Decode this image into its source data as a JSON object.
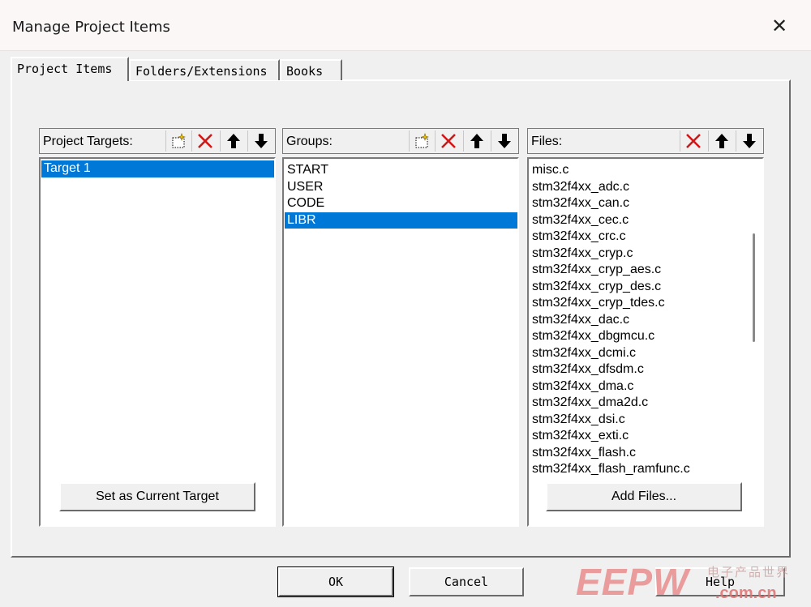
{
  "window": {
    "title": "Manage Project Items",
    "close_glyph": "✕"
  },
  "tabs": [
    {
      "label": "Project Items"
    },
    {
      "label": "Folders/Extensions"
    },
    {
      "label": "Books"
    }
  ],
  "targets_panel": {
    "label": "Project Targets:",
    "items": [
      "Target 1"
    ],
    "selected_index": 0,
    "action_button": "Set as Current Target"
  },
  "groups_panel": {
    "label": "Groups:",
    "items": [
      "START",
      "USER",
      "CODE",
      "LIBR"
    ],
    "selected_index": 3
  },
  "files_panel": {
    "label": "Files:",
    "items": [
      "misc.c",
      "stm32f4xx_adc.c",
      "stm32f4xx_can.c",
      "stm32f4xx_cec.c",
      "stm32f4xx_crc.c",
      "stm32f4xx_cryp.c",
      "stm32f4xx_cryp_aes.c",
      "stm32f4xx_cryp_des.c",
      "stm32f4xx_cryp_tdes.c",
      "stm32f4xx_dac.c",
      "stm32f4xx_dbgmcu.c",
      "stm32f4xx_dcmi.c",
      "stm32f4xx_dfsdm.c",
      "stm32f4xx_dma.c",
      "stm32f4xx_dma2d.c",
      "stm32f4xx_dsi.c",
      "stm32f4xx_exti.c",
      "stm32f4xx_flash.c",
      "stm32f4xx_flash_ramfunc.c"
    ],
    "action_button": "Add Files..."
  },
  "dialog_buttons": {
    "ok": "OK",
    "cancel": "Cancel",
    "help": "Help"
  },
  "watermark": {
    "logo": "EEPW",
    "tagline": "电子产品世界",
    "domain": ".com.cn"
  },
  "icons": {
    "new": "new-item-icon",
    "delete": "delete-x-icon",
    "up": "move-up-arrow-icon",
    "down": "move-down-arrow-icon"
  },
  "colors": {
    "selection": "#0078d7",
    "delete_red": "#d01818",
    "watermark_red": "#e07070"
  }
}
